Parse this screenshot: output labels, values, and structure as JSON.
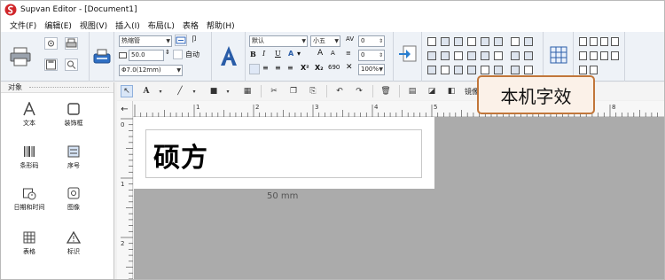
{
  "window": {
    "title": "Supvan Editor - [Document1]"
  },
  "menu": [
    "文件(F)",
    "编辑(E)",
    "视图(V)",
    "插入(I)",
    "布局(L)",
    "表格",
    "帮助(H)"
  ],
  "ribbon": {
    "paper_type": "热缩管",
    "length_value": "50.0",
    "auto_label": "自动",
    "tube_size": "Φ7.0(12mm)",
    "font_name": "默认",
    "font_size": "小五",
    "char_spacing": "0",
    "line_spacing": "0",
    "scale_value": "100%",
    "format_buttons": [
      "B",
      "I",
      "U",
      "A",
      "A",
      "A",
      "X²",
      "X₂",
      "690"
    ]
  },
  "toolbar2": {
    "mirror_label": "镜像",
    "flip_label": "翻转"
  },
  "objects_panel": {
    "title": "对象",
    "items": [
      {
        "label": "文本",
        "icon": "text-a-icon"
      },
      {
        "label": "装饰框",
        "icon": "frame-icon"
      },
      {
        "label": "条形码",
        "icon": "barcode-icon"
      },
      {
        "label": "序号",
        "icon": "serial-icon"
      },
      {
        "label": "日期和时间",
        "icon": "datetime-icon"
      },
      {
        "label": "图像",
        "icon": "image-icon"
      },
      {
        "label": "表格",
        "icon": "table-icon"
      },
      {
        "label": "标识",
        "icon": "warning-icon"
      }
    ]
  },
  "ruler": {
    "h_numbers": [
      "1",
      "2",
      "3",
      "4",
      "5",
      "8"
    ],
    "v_numbers": [
      "0",
      "1",
      "2"
    ]
  },
  "label": {
    "text": "硕方",
    "size_caption": "50 mm"
  },
  "callout": {
    "text": "本机字效"
  },
  "colors": {
    "accent": "#c1763a",
    "callout_bg": "#fbf1e8",
    "canvas_bg": "#ababab",
    "ribbon_bg": "#eef2f7"
  }
}
